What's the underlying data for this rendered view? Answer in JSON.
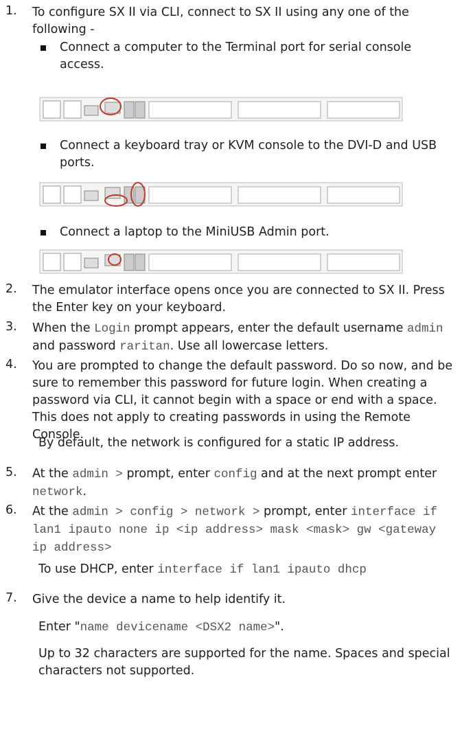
{
  "steps": [
    {
      "number": "1.",
      "text": "To configure SX II via CLI, connect to SX II using any one of the following -",
      "sub_items": [
        "Connect a computer to the Terminal port for serial console access.",
        "Connect a keyboard tray or KVM console to the DVI-D and USB ports.",
        "Connect a laptop to the MiniUSB Admin port."
      ]
    },
    {
      "number": "2.",
      "text": "The emulator interface opens once you are connected to SX II. Press the Enter key on your keyboard."
    },
    {
      "number": "3.",
      "parts": [
        "When the ",
        "Login",
        " prompt appears, enter the default username ",
        "admin",
        " and password ",
        "raritan",
        ". Use all lowercase letters."
      ]
    },
    {
      "number": "4.",
      "text": "You are prompted to change the default password. Do so now, and be sure to remember this password for future login. When creating a password via CLI, it cannot begin with a space or end with a space. This does not apply to creating passwords in using the Remote Console.",
      "note": "By default, the network is configured for a static IP address."
    },
    {
      "number": "5.",
      "parts": [
        "At the ",
        "admin >",
        " prompt, enter ",
        "config",
        " and at the next prompt enter ",
        "network",
        "."
      ]
    },
    {
      "number": "6.",
      "parts": [
        "At the ",
        "admin > config > network >",
        " prompt, enter ",
        "interface if lan1 ipauto none ip <ip address> mask <mask> gw <gateway ip address>"
      ],
      "note_parts": [
        "To use DHCP, enter ",
        "interface if lan1 ipauto dhcp"
      ]
    },
    {
      "number": "7.",
      "text": "Give the device a name to help identify it.",
      "note_parts": [
        "Enter \"",
        "name devicename <DSX2 name>",
        "\"."
      ],
      "note2": "Up to 32 characters are supported for the name. Spaces and special characters not supported."
    }
  ],
  "colors": {
    "text": "#1f1f1f",
    "code": "#555555",
    "highlight_circle": "#c0392b"
  }
}
